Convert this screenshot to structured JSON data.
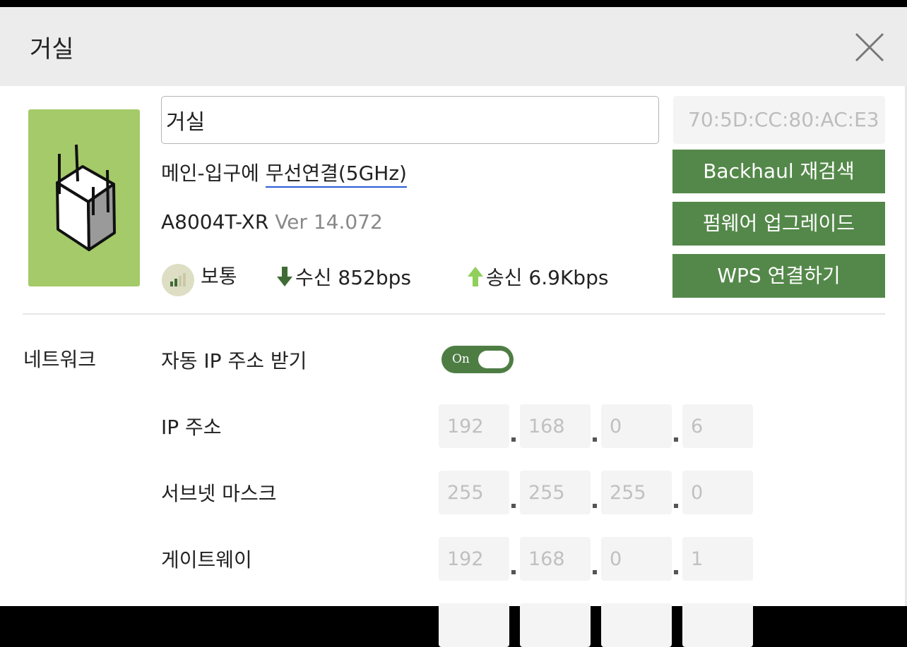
{
  "header": {
    "title": "거실"
  },
  "device": {
    "name_value": "거실",
    "mac": "70:5D:CC:80:AC:E3",
    "connection_prefix": "메인-입구에 ",
    "connection_link": "무선연결(5GHz)",
    "model": "A8004T-XR",
    "version": "Ver 14.072",
    "signal_label": "보통",
    "rx_label": "수신 852bps",
    "tx_label": "송신 6.9Kbps"
  },
  "actions": {
    "backhaul": "Backhaul 재검색",
    "firmware": "펌웨어 업그레이드",
    "wps": "WPS 연결하기"
  },
  "network": {
    "section_label": "네트워크",
    "auto_ip_label": "자동 IP 주소 받기",
    "auto_ip_toggle": "On",
    "auto_ip_on": true,
    "ip_label": "IP 주소",
    "ip": [
      "192",
      "168",
      "0",
      "6"
    ],
    "subnet_label": "서브넷 마스크",
    "subnet": [
      "255",
      "255",
      "255",
      "0"
    ],
    "gateway_label": "게이트웨이",
    "gateway": [
      "192",
      "168",
      "0",
      "1"
    ]
  },
  "colors": {
    "accent_green": "#54884a",
    "tile_green": "#a4ca69",
    "link_underline": "#2a5bd7",
    "rx_arrow": "#3f6b35",
    "tx_arrow": "#8fcf5a"
  },
  "icons": [
    "close-icon",
    "router-device-icon",
    "signal-strength-icon",
    "download-arrow-icon",
    "upload-arrow-icon"
  ]
}
